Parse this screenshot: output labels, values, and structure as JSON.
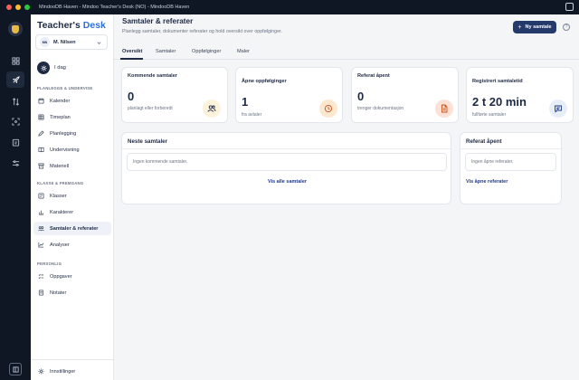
{
  "window": {
    "title": "MindooDB Haven - Mindoo Teacher's Desk (NO) - MindooDB Haven",
    "colors": {
      "chrome": "#0f1724",
      "accent": "#243a6a"
    }
  },
  "rail": {
    "icons": [
      "logo-icon",
      "grid-icon",
      "rocket-icon",
      "arrows-icon",
      "focus-icon",
      "clipboard-icon",
      "sliders-icon",
      "panel-icon"
    ]
  },
  "sidebar": {
    "brand_part1": "Teacher's",
    "brand_part2": "Desk",
    "user": {
      "initials": "MN",
      "name": "M. Nilsen"
    },
    "today_label": "I dag",
    "sections": [
      {
        "header": "PLANLEGGE & UNDERVISE",
        "items": [
          "Kalender",
          "Timeplan",
          "Planlegging",
          "Undervisning",
          "Materiell"
        ]
      },
      {
        "header": "KLASSE & FREMGANG",
        "items": [
          "Klasser",
          "Karakterer",
          "Samtaler & referater",
          "Analyser"
        ]
      },
      {
        "header": "PERSONLIG",
        "items": [
          "Oppgaver",
          "Notater"
        ]
      }
    ],
    "active_item": "Samtaler & referater",
    "settings_label": "Innstillinger"
  },
  "header": {
    "title": "Samtaler & referater",
    "subtitle": "Planlegg samtaler, dokumenter referater og hold oversikt over oppfølginger.",
    "new_button": "Ny samtale",
    "help_icon": "?"
  },
  "tabs": [
    "Oversikt",
    "Samtaler",
    "Oppfølginger",
    "Maler"
  ],
  "active_tab": "Oversikt",
  "stats": [
    {
      "title": "Kommende samtaler",
      "value": "0",
      "desc": "planlagt eller forberedt",
      "icon": "users-icon",
      "color": "#fdf3dc"
    },
    {
      "title": "Åpne oppfølginger",
      "value": "1",
      "desc": "fra avtaler",
      "icon": "clock-icon",
      "color": "#fde7cf"
    },
    {
      "title": "Referat åpent",
      "value": "0",
      "desc": "trenger dokumentasjon",
      "icon": "document-icon",
      "color": "#fde1d6"
    },
    {
      "title": "Registrert samtaletid",
      "value": "2 t 20 min",
      "desc": "fullførte samtaler",
      "icon": "chat-icon",
      "color": "#e8eef8"
    }
  ],
  "panels": {
    "next": {
      "title": "Neste samtaler",
      "empty": "Ingen kommende samtaler.",
      "link": "Vis alle samtaler"
    },
    "open": {
      "title": "Referat åpent",
      "empty": "Ingen åpne referater.",
      "link": "Vis åpne referater"
    }
  }
}
